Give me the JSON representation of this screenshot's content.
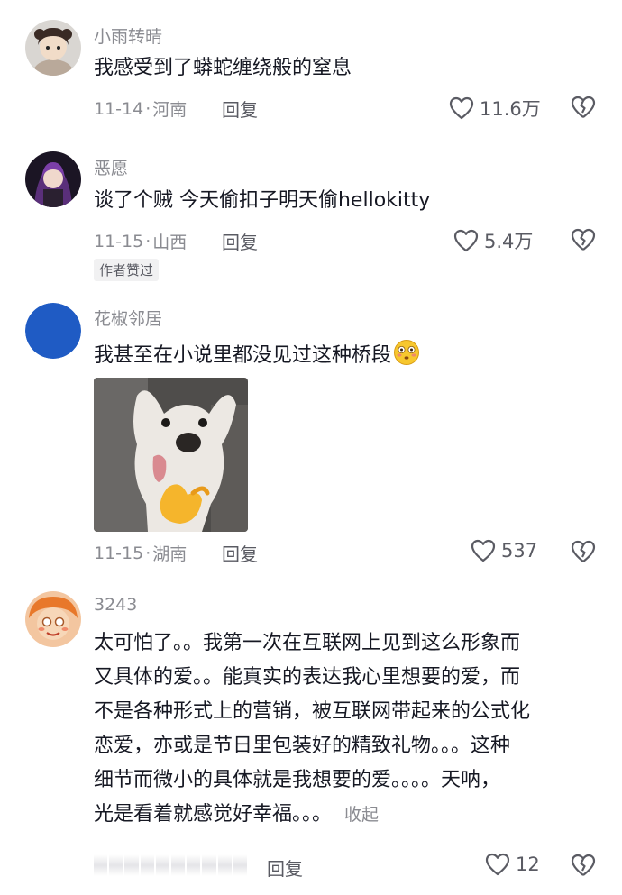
{
  "comments": [
    {
      "username": "小雨转晴",
      "text": "我感受到了蟒蛇缠绕般的窒息",
      "date": "11-14",
      "location": "河南",
      "reply_label": "回复",
      "likes": "11.6万"
    },
    {
      "username": "恶愿",
      "text": "谈了个贼 今天偷扣子明天偷hellokitty",
      "date": "11-15",
      "location": "山西",
      "reply_label": "回复",
      "likes": "5.4万",
      "badge": "作者赞过"
    },
    {
      "username": "花椒邻居",
      "text": "我甚至在小说里都没见过这种桥段",
      "date": "11-15",
      "location": "湖南",
      "reply_label": "回复",
      "likes": "537"
    },
    {
      "username": "3243",
      "text_lines": [
        "太可怕了。。我第一次在互联网上见到这么形象而",
        "又具体的爱。。能真实的表达我心里想要的爱，而",
        "不是各种形式上的营销，被互联网带起来的公式化",
        "恋爱，亦或是节日里包装好的精致礼物。。。这种",
        "细节而微小的具体就是我想要的爱。。。。天呐，",
        "光是看着就感觉好幸福。。。"
      ],
      "collapse_label": "收起",
      "reply_label": "回复",
      "likes": "12"
    }
  ],
  "meta_separator": "·",
  "icons": {
    "like": "heart-outline-icon",
    "dislike": "broken-heart-icon",
    "emoji": "flushed-smiley-emoji"
  },
  "colors": {
    "text": "#161823",
    "muted": "#8a8b91",
    "action": "#5a5b63"
  }
}
